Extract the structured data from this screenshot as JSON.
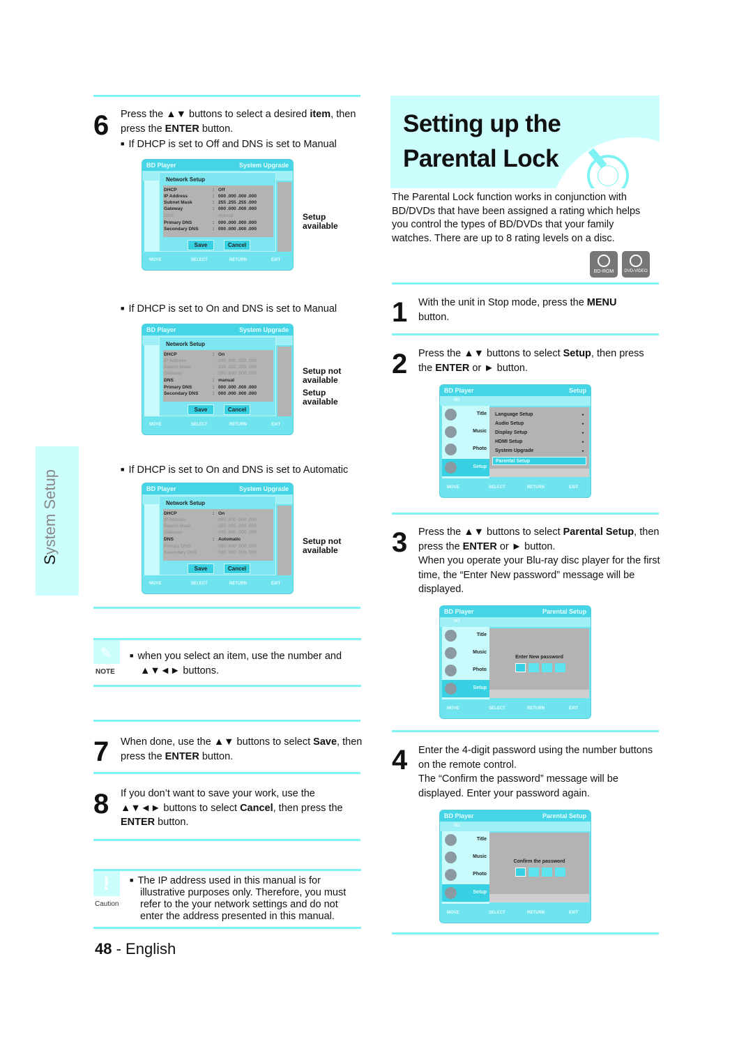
{
  "sidebar_tab": {
    "first_letter": "S",
    "rest": "ystem Setup"
  },
  "page_footer": {
    "number": "48",
    "separator": " - ",
    "language": "English"
  },
  "left": {
    "step6": {
      "number": "6",
      "text_a": "Press the ▲▼ buttons to select a desired ",
      "text_b": "item",
      "text_c": ", then press the ",
      "text_d": "ENTER",
      "text_e": " button.",
      "bullet1": "If DHCP is set to Off and DNS is set to Manual",
      "bullet2": "If DHCP is set to On and DNS is set to Manual",
      "bullet3": "If DHCP is set to On and DNS is set to Automatic"
    },
    "screens": [
      {
        "header_left": "BD Player",
        "header_right": "System Upgrade",
        "title": "Network Setup",
        "rows": [
          {
            "k": "DHCP",
            "v": "Off",
            "dim": false
          },
          {
            "k": "IP Address",
            "v": "000   .000   .000   .000",
            "dim": false
          },
          {
            "k": "Subnet Mask",
            "v": "255   .255   .255   .000",
            "dim": false
          },
          {
            "k": "Gateway",
            "v": "000   .000   .000   .000",
            "dim": false
          },
          {
            "k": "DNS",
            "v": "manual",
            "dim": true
          },
          {
            "k": "Primary DNS",
            "v": "000   .000   .000   .000",
            "dim": false
          },
          {
            "k": "Secondary DNS",
            "v": "000   .000   .000   .000",
            "dim": false
          }
        ],
        "save": "Save",
        "cancel": "Cancel",
        "callouts": [
          "Setup available"
        ]
      },
      {
        "header_left": "BD Player",
        "header_right": "System Upgrade",
        "title": "Network Setup",
        "rows": [
          {
            "k": "DHCP",
            "v": "On",
            "dim": false
          },
          {
            "k": "IP Address",
            "v": "000   .000   .000   .000",
            "dim": true
          },
          {
            "k": "Subnet Mask",
            "v": "255   .255   .255   .000",
            "dim": true
          },
          {
            "k": "Gateway",
            "v": "000   .000   .000   .000",
            "dim": true
          },
          {
            "k": "DNS",
            "v": "manual",
            "dim": false
          },
          {
            "k": "Primary DNS",
            "v": "000   .000   .000   .000",
            "dim": false
          },
          {
            "k": "Secondary DNS",
            "v": "000   .000   .000   .000",
            "dim": false
          }
        ],
        "save": "Save",
        "cancel": "Cancel",
        "callouts": [
          "Setup not available",
          "Setup available"
        ]
      },
      {
        "header_left": "BD Player",
        "header_right": "System Upgrade",
        "title": "Network Setup",
        "rows": [
          {
            "k": "DHCP",
            "v": "On",
            "dim": false
          },
          {
            "k": "IP Address",
            "v": "000   .000   .000   .000",
            "dim": true
          },
          {
            "k": "Subnet Mask",
            "v": "255   .255   .255   .000",
            "dim": true
          },
          {
            "k": "Gateway",
            "v": "000   .000   .000   .000",
            "dim": true
          },
          {
            "k": "DNS",
            "v": "Automatic",
            "dim": false
          },
          {
            "k": "Primary DNS",
            "v": "000   .000   .000   .000",
            "dim": true
          },
          {
            "k": "Secondary DNS",
            "v": "000   .000   .000   .000",
            "dim": true
          }
        ],
        "save": "Save",
        "cancel": "Cancel",
        "callouts": [
          "Setup not available"
        ]
      }
    ],
    "osd_footer": {
      "move": "MOVE",
      "select": "SELECT",
      "return": "RETURN",
      "exit": "EXIT"
    },
    "note": {
      "label": "NOTE",
      "text": "when you select an item, use the number and ▲▼◄► buttons."
    },
    "step7": {
      "number": "7",
      "a": "When done, use the ▲▼ buttons to select ",
      "b": "Save",
      "c": ", then press the ",
      "d": "ENTER",
      "e": " button."
    },
    "step8": {
      "number": "8",
      "a": "If you don’t want to save your work, use the ▲▼◄► buttons to select ",
      "b": "Cancel",
      "c": ", then press the ",
      "d": "ENTER",
      "e": " button."
    },
    "caution": {
      "label": "Caution",
      "text": "The IP address used in this manual is for illustrative purposes only. Therefore, you must refer to the your network settings and do not enter the address presented in this manual."
    }
  },
  "right": {
    "title": "Setting up the Parental Lock",
    "intro": "The Parental Lock function works in conjunction with BD/DVDs that have been assigned a rating which helps you control the types of BD/DVDs that your family watches. There are up to 8 rating levels on a disc.",
    "disc_badges": [
      "BD-ROM",
      "DVD-VIDEO"
    ],
    "step1": {
      "number": "1",
      "a": "With the unit in Stop mode, press the ",
      "b": "MENU",
      "c": " button."
    },
    "step2": {
      "number": "2",
      "a": "Press the ▲▼ buttons to select ",
      "b": "Setup",
      "c": ", then press the ",
      "d": "ENTER",
      "e": " or ► button."
    },
    "step3": {
      "number": "3",
      "a": "Press the ▲▼ buttons to select ",
      "b": "Parental Setup",
      "c": ", then press the ",
      "d": "ENTER",
      "e": " or ► button.",
      "f": "When you operate your Blu-ray disc player for the first time, the “Enter New password” message will be displayed."
    },
    "step4": {
      "number": "4",
      "a": "Enter the 4-digit password using the number buttons on the remote control.",
      "b": "The “Confirm the password” message will be displayed. Enter your password again."
    },
    "osd_setup": {
      "header_left": "BD Player",
      "header_right": "Setup",
      "disc": "BD",
      "side": [
        "Title",
        "Music",
        "Photo",
        "Setup"
      ],
      "menu": [
        "Language Setup",
        "Audio Setup",
        "Display Setup",
        "HDMI Setup",
        "System Upgrade",
        "Parental Setup"
      ]
    },
    "osd_new_pw": {
      "header_left": "BD Player",
      "header_right": "Parental Setup",
      "disc": "BD",
      "side": [
        "Title",
        "Music",
        "Photo",
        "Setup"
      ],
      "prompt": "Enter New password"
    },
    "osd_confirm_pw": {
      "header_left": "BD Player",
      "header_right": "Parental Setup",
      "disc": "BD",
      "side": [
        "Title",
        "Music",
        "Photo",
        "Setup"
      ],
      "prompt": "Confirm the password"
    }
  }
}
